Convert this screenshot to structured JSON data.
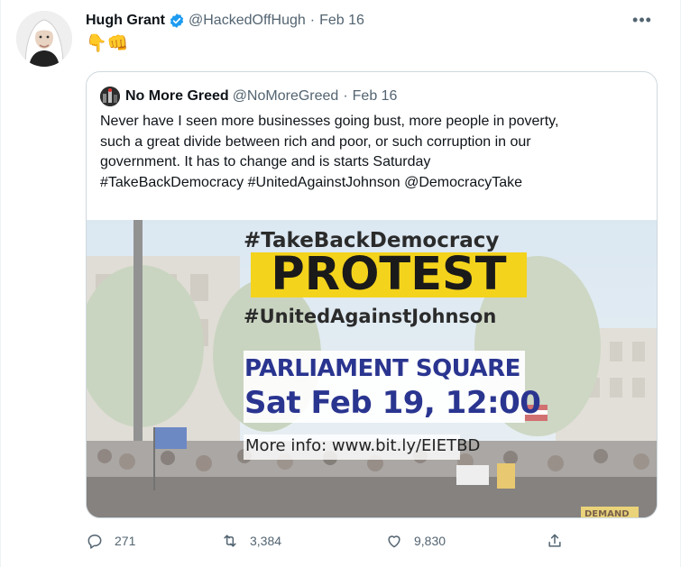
{
  "tweet": {
    "author_name": "Hugh Grant",
    "handle": "@HackedOffHugh",
    "separator": "·",
    "date": "Feb 16",
    "emojis": "👇👊",
    "more_label": "•••"
  },
  "quote": {
    "author_name": "No More Greed",
    "handle": "@NoMoreGreed",
    "separator": "·",
    "date": "Feb 16",
    "text_lines": [
      "Never have I seen more businesses going bust, more people in poverty,",
      "such a great divide between rich and poor, or such corruption in our",
      "government. It has to change and is starts Saturday",
      "#TakeBackDemocracy #UnitedAgainstJohnson @DemocracyTake"
    ]
  },
  "poster": {
    "hashtag_top": "#TakeBackDemocracy",
    "headline": "PROTEST",
    "hashtag_bottom": "#UnitedAgainstJohnson",
    "location": "PARLIAMENT SQUARE",
    "datetime": "Sat Feb 19, 12:00",
    "info": "More info: www.bit.ly/EIETBD",
    "sign_text": "DEMAND",
    "headline_bg": "#f4d31c",
    "location_color": "#2a3590"
  },
  "actions": {
    "replies": "271",
    "retweets": "3,384",
    "likes": "9,830"
  },
  "colors": {
    "verified": "#1d9bf0",
    "muted": "#536471",
    "border": "#cfd9de"
  }
}
